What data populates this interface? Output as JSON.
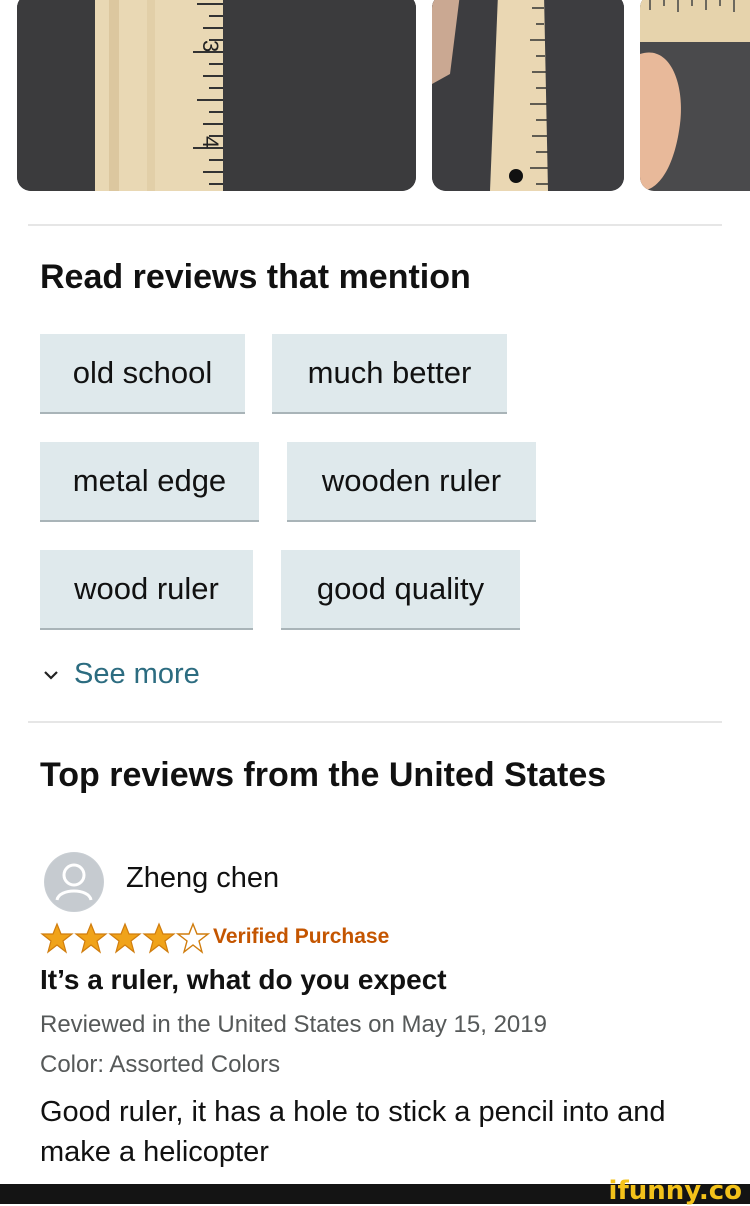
{
  "mentions": {
    "heading": "Read reviews that mention",
    "chips": [
      "old school",
      "much better",
      "metal edge",
      "wooden ruler",
      "wood ruler",
      "good quality"
    ],
    "see_more": "See more"
  },
  "top_reviews": {
    "heading": "Top reviews from the United States"
  },
  "review": {
    "reviewer": "Zheng chen",
    "rating": 4,
    "rating_max": 5,
    "verified": "Verified Purchase",
    "title": "It’s a ruler, what do you expect",
    "date_line": "Reviewed in the United States on May 15, 2019",
    "color_line": "Color: Assorted Colors",
    "body": "Good ruler, it has a hole to stick a pencil into and make a helicopter"
  },
  "watermark": "ifunny.co",
  "colors": {
    "chip_bg": "#dfe9ec",
    "link": "#2c6c80",
    "star": "#f0a31a",
    "verified": "#c45500"
  }
}
